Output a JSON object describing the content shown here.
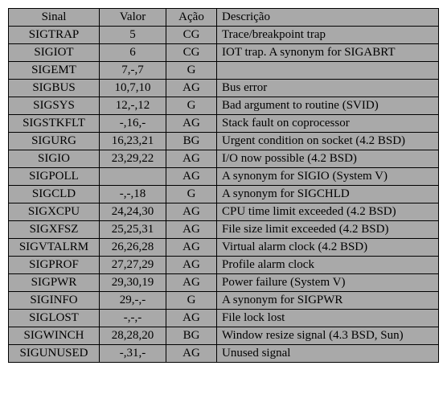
{
  "headers": {
    "sinal": "Sinal",
    "valor": "Valor",
    "acao": "Ação",
    "descricao": "Descrição"
  },
  "rows": [
    {
      "sinal": "SIGTRAP",
      "valor": "5",
      "acao": "CG",
      "descricao": "Trace/breakpoint trap"
    },
    {
      "sinal": "SIGIOT",
      "valor": "6",
      "acao": "CG",
      "descricao": "IOT trap. A synonym for SIGABRT"
    },
    {
      "sinal": "SIGEMT",
      "valor": "7,-,7",
      "acao": "G",
      "descricao": ""
    },
    {
      "sinal": "SIGBUS",
      "valor": "10,7,10",
      "acao": "AG",
      "descricao": "Bus error"
    },
    {
      "sinal": "SIGSYS",
      "valor": "12,-,12",
      "acao": "G",
      "descricao": "Bad argument to routine (SVID)"
    },
    {
      "sinal": "SIGSTKFLT",
      "valor": "-,16,-",
      "acao": "AG",
      "descricao": "Stack fault on coprocessor"
    },
    {
      "sinal": "SIGURG",
      "valor": "16,23,21",
      "acao": "BG",
      "descricao": "Urgent condition on socket (4.2 BSD)"
    },
    {
      "sinal": "SIGIO",
      "valor": "23,29,22",
      "acao": "AG",
      "descricao": "I/O now possible (4.2 BSD)"
    },
    {
      "sinal": "SIGPOLL",
      "valor": "",
      "acao": "AG",
      "descricao": "A synonym for SIGIO (System V)"
    },
    {
      "sinal": "SIGCLD",
      "valor": "-,-,18",
      "acao": "G",
      "descricao": "A synonym for SIGCHLD"
    },
    {
      "sinal": "SIGXCPU",
      "valor": "24,24,30",
      "acao": "AG",
      "descricao": "CPU time limit exceeded (4.2 BSD)"
    },
    {
      "sinal": "SIGXFSZ",
      "valor": "25,25,31",
      "acao": "AG",
      "descricao": "File size limit exceeded (4.2 BSD)"
    },
    {
      "sinal": "SIGVTALRM",
      "valor": "26,26,28",
      "acao": "AG",
      "descricao": "Virtual alarm clock (4.2 BSD)"
    },
    {
      "sinal": "SIGPROF",
      "valor": "27,27,29",
      "acao": "AG",
      "descricao": "Profile alarm clock"
    },
    {
      "sinal": "SIGPWR",
      "valor": "29,30,19",
      "acao": "AG",
      "descricao": "Power failure (System V)"
    },
    {
      "sinal": "SIGINFO",
      "valor": "29,-,-",
      "acao": "G",
      "descricao": "A synonym for SIGPWR"
    },
    {
      "sinal": "SIGLOST",
      "valor": "-,-,-",
      "acao": "AG",
      "descricao": "File lock lost"
    },
    {
      "sinal": "SIGWINCH",
      "valor": "28,28,20",
      "acao": "BG",
      "descricao": "Window resize signal (4.3 BSD, Sun)"
    },
    {
      "sinal": "SIGUNUSED",
      "valor": "-,31,-",
      "acao": "AG",
      "descricao": "Unused signal"
    }
  ]
}
